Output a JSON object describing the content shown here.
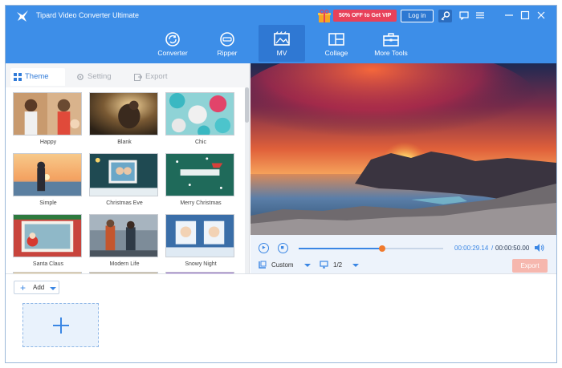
{
  "app": {
    "title": "Tipard Video Converter Ultimate",
    "promo_label": "50% OFF to Get VIP",
    "login_label": "Log in"
  },
  "nav": [
    {
      "label": "Converter",
      "icon": "converter-icon",
      "active": false
    },
    {
      "label": "Ripper",
      "icon": "ripper-disc-icon",
      "active": false
    },
    {
      "label": "MV",
      "icon": "mv-image-icon",
      "active": true
    },
    {
      "label": "Collage",
      "icon": "collage-icon",
      "active": false
    },
    {
      "label": "More Tools",
      "icon": "toolbox-icon",
      "active": false
    }
  ],
  "tabs": [
    {
      "label": "Theme",
      "active": true
    },
    {
      "label": "Setting",
      "active": false
    },
    {
      "label": "Export",
      "active": false
    }
  ],
  "themes": [
    {
      "name": "Happy"
    },
    {
      "name": "Blank"
    },
    {
      "name": "Chic"
    },
    {
      "name": "Simple"
    },
    {
      "name": "Christmas Eve"
    },
    {
      "name": "Merry Christmas"
    },
    {
      "name": "Santa Claus"
    },
    {
      "name": "Modern Life"
    },
    {
      "name": "Snowy Night"
    }
  ],
  "player": {
    "current_time": "00:00:29.14",
    "separator": "/",
    "total_time": "00:00:50.00",
    "progress": 0.58,
    "aspect_ratio": "Custom",
    "page": "1/2",
    "export_label": "Export"
  },
  "media": {
    "add_label": "Add"
  },
  "colors": {
    "header": "#3d8ee8",
    "accent": "#3a86e4",
    "promo": "#e8415a",
    "export_disabled": "#f6b7ae"
  }
}
